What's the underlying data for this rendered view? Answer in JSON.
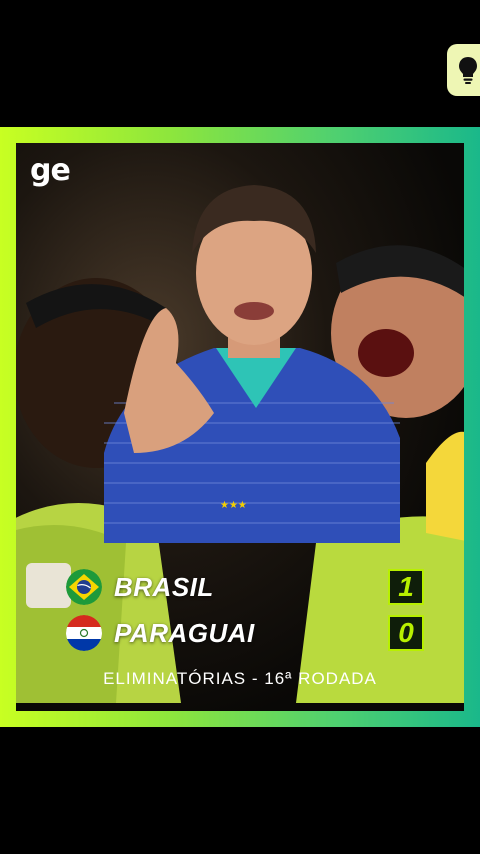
{
  "app": {
    "logo_text": "ge"
  },
  "tip_button": {
    "icon": "lightbulb-icon"
  },
  "match": {
    "home": {
      "name": "BRASIL",
      "score": "1",
      "flag_icon": "brazil-flag-icon"
    },
    "away": {
      "name": "PARAGUAI",
      "score": "0",
      "flag_icon": "paraguay-flag-icon"
    },
    "round": "ELIMINATÓRIAS - 16ª RODADA"
  },
  "colors": {
    "frame_start": "#c8ff22",
    "frame_end": "#1ab88a",
    "score_accent": "#b8f000",
    "tip_button_bg": "#eef6b4"
  }
}
